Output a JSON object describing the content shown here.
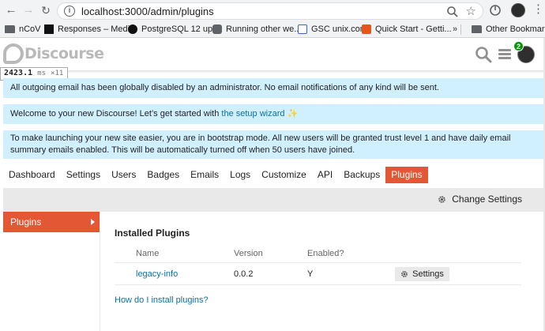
{
  "browser": {
    "url": "localhost:3000/admin/plugins",
    "bookmarks": [
      {
        "label": "nCoV",
        "icon": "folder-icon"
      },
      {
        "label": "Responses – Medi...",
        "icon": "medium-icon"
      },
      {
        "label": "PostgreSQL 12 up...",
        "icon": "postgresql-icon"
      },
      {
        "label": "Running other we...",
        "icon": "site-icon"
      },
      {
        "label": "GSC unix.com",
        "icon": "gsc-icon"
      },
      {
        "label": "Quick Start - Getti...",
        "icon": "quickstart-icon"
      },
      {
        "label": "Other Bookmarks",
        "icon": "folder-icon"
      }
    ]
  },
  "header": {
    "logo_text": "Discourse",
    "notification_count": "2"
  },
  "timing": {
    "value": "2423.1",
    "unit": "ms",
    "count": "×11"
  },
  "alerts": {
    "email_disabled": "All outgoing email has been globally disabled by an administrator. No email notifications of any kind will be sent.",
    "welcome_prefix": "Welcome to your new Discourse! Let’s get started with ",
    "welcome_link": "the setup wizard",
    "welcome_suffix": "✨",
    "bootstrap": "To make launching your new site easier, you are in bootstrap mode. All new users will be granted trust level 1 and have daily email summary emails enabled. This will be automatically turned off when 50 users have joined."
  },
  "admin_nav": {
    "tabs": [
      "Dashboard",
      "Settings",
      "Users",
      "Badges",
      "Emails",
      "Logs",
      "Customize",
      "API",
      "Backups",
      "Plugins"
    ],
    "active": "Plugins"
  },
  "subbar": {
    "change_settings": "Change Settings"
  },
  "sidebar": {
    "item": "Plugins"
  },
  "plugins": {
    "title": "Installed Plugins",
    "columns": [
      "Name",
      "Version",
      "Enabled?"
    ],
    "rows": [
      {
        "name": "legacy-info",
        "version": "0.0.2",
        "enabled": "Y",
        "settings_label": "Settings"
      }
    ],
    "help_link": "How do I install plugins?"
  },
  "colors": {
    "accent": "#e45735",
    "alert_bg": "#d1f0ff",
    "link": "#0a70a5",
    "badge": "#009900"
  }
}
